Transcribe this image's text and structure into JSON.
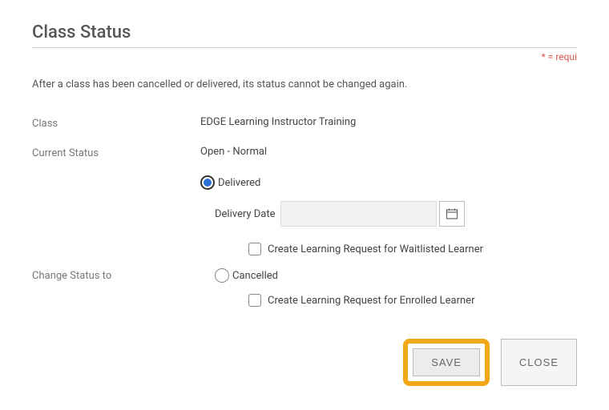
{
  "page": {
    "title": "Class Status",
    "required_note": "* = requi",
    "description": "After a class has been cancelled or delivered, its status cannot be changed again."
  },
  "fields": {
    "class_label": "Class",
    "class_value": "EDGE Learning Instructor Training",
    "current_status_label": "Current Status",
    "current_status_value": "Open - Normal",
    "change_status_label": "Change Status to"
  },
  "options": {
    "delivered_label": "Delivered",
    "delivery_date_label": "Delivery Date",
    "delivery_date_value": "",
    "waitlisted_checkbox_label": "Create Learning Request for Waitlisted Learner",
    "cancelled_label": "Cancelled",
    "enrolled_checkbox_label": "Create Learning Request for Enrolled Learner"
  },
  "buttons": {
    "save": "SAVE",
    "close": "CLOSE"
  }
}
